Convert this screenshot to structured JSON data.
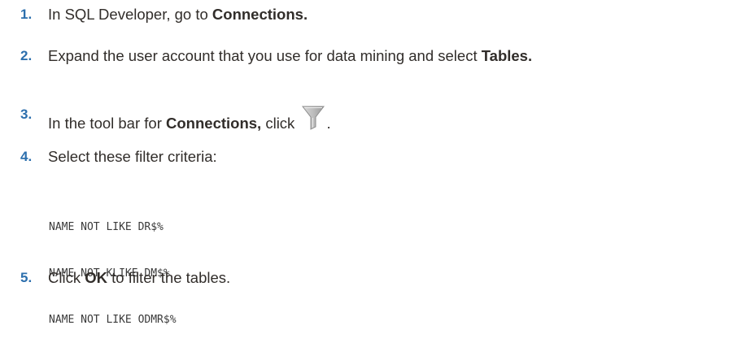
{
  "steps": [
    {
      "number": "1.",
      "text_before": "In SQL Developer, go to ",
      "bold": "Connections.",
      "text_after": ""
    },
    {
      "number": "2.",
      "text_before": "Expand the user account that you use for data mining and select ",
      "bold": "Tables.",
      "text_after": ""
    },
    {
      "number": "3.",
      "text_before": "In the tool bar for ",
      "bold": "Connections,",
      "text_middle": " click ",
      "icon": "filter-funnel-icon",
      "text_after": "."
    },
    {
      "number": "4.",
      "text_before": "Select these filter criteria:"
    },
    {
      "number": "5.",
      "text_before": "Click ",
      "bold": "OK",
      "text_after": " to filter the tables."
    }
  ],
  "filter_criteria": [
    "NAME NOT LIKE DR$%",
    "NAME NOT KLIKE DM$%",
    "NAME NOT LIKE ODMR$%"
  ],
  "colors": {
    "step_number": "#2c6fad",
    "text": "#312d2a",
    "code": "#3a3a3a"
  }
}
